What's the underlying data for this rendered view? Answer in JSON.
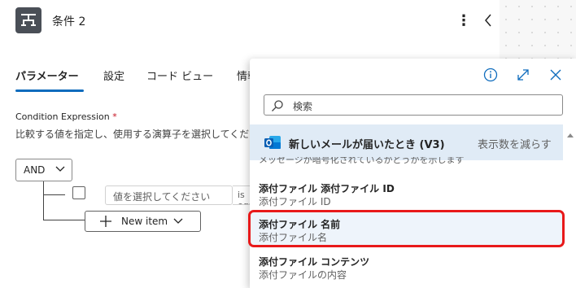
{
  "header": {
    "title": "条件 2",
    "more_icon": "⋮"
  },
  "tabs": [
    {
      "label": "パラメーター",
      "active": true
    },
    {
      "label": "設定",
      "active": false
    },
    {
      "label": "コード ビュー",
      "active": false
    },
    {
      "label": "情報",
      "active": false
    }
  ],
  "condition": {
    "label": "Condition Expression",
    "required_mark": "*",
    "description": "比較する値を指定し、使用する演算子を選択してください",
    "group_operator": "AND",
    "value_placeholder": "値を選択してください",
    "operator_value": "is equal to",
    "new_item_label": "New item"
  },
  "flyout": {
    "search_placeholder": "検索",
    "group": {
      "name": "新しいメールが届いたとき (V3)",
      "toggle": "表示数を減らす"
    },
    "cut_item_text": "メッセージが暗号化されているかどうかを示します",
    "items": [
      {
        "name": "添付ファイル 添付ファイル ID",
        "desc": "添付ファイル ID"
      },
      {
        "name": "添付ファイル 名前",
        "desc": "添付ファイル名",
        "selected": true
      },
      {
        "name": "添付ファイル コンテンツ",
        "desc": "添付ファイルの内容"
      }
    ]
  },
  "colors": {
    "accent": "#0f6cbd",
    "highlight": "#e8191a",
    "group_bg": "#e0ebf6"
  }
}
